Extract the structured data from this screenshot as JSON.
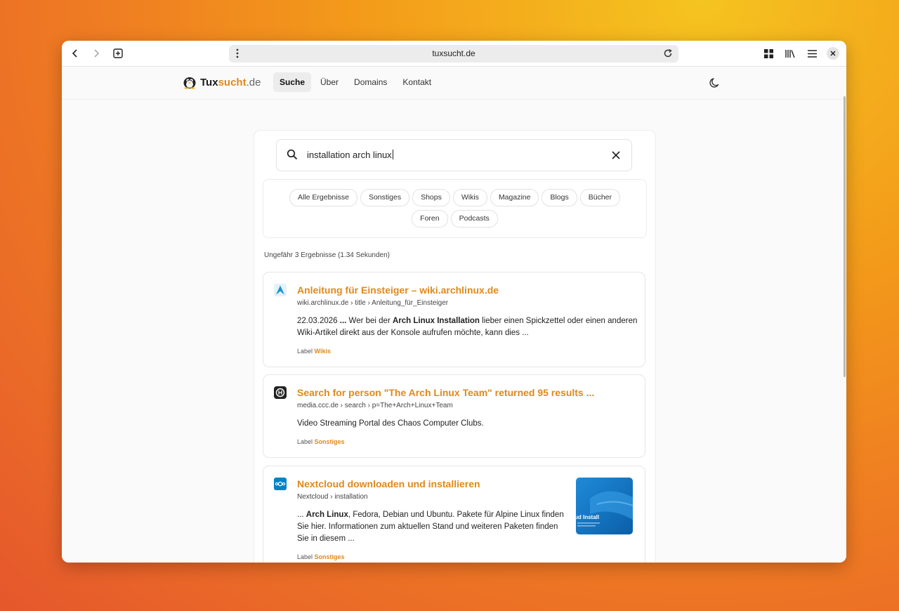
{
  "browser": {
    "url": "tuxsucht.de",
    "accent": "#e0891a"
  },
  "site": {
    "logo_tux": "Tux",
    "logo_sucht": "sucht",
    "logo_de": ".de",
    "nav": [
      {
        "label": "Suche",
        "active": true
      },
      {
        "label": "Über"
      },
      {
        "label": "Domains"
      },
      {
        "label": "Kontakt"
      }
    ]
  },
  "search": {
    "query": "installation arch linux",
    "filters_row1": [
      "Alle Ergebnisse",
      "Sonstiges",
      "Shops",
      "Wikis",
      "Magazine",
      "Blogs",
      "Bücher"
    ],
    "filters_row2": [
      "Foren",
      "Podcasts"
    ],
    "result_count": "Ungefähr 3 Ergebnisse (1.34 Sekunden)"
  },
  "results": [
    {
      "title": "Anleitung für Einsteiger – wiki.archlinux.de",
      "crumb": "wiki.archlinux.de › title › Anleitung_für_Einsteiger",
      "snippet_parts": [
        {
          "text": "22.03.2026 ",
          "bold": false
        },
        {
          "text": "...",
          "bold": true
        },
        {
          "text": " Wer bei der ",
          "bold": false
        },
        {
          "text": "Arch Linux Installation",
          "bold": true
        },
        {
          "text": " lieber einen Spickzettel oder einen anderen Wiki-Artikel direkt aus der Konsole aufrufen möchte, kann dies ...",
          "bold": false
        }
      ],
      "label_prefix": "Label",
      "label": "Wikis"
    },
    {
      "title": "Search for person \"The Arch Linux Team\" returned 95 results ...",
      "crumb": "media.ccc.de › search › p=The+Arch+Linux+Team",
      "snippet_parts": [
        {
          "text": "Video Streaming Portal des Chaos Computer Clubs.",
          "bold": false
        }
      ],
      "label_prefix": "Label",
      "label": "Sonstiges"
    },
    {
      "title": "Nextcloud downloaden und installieren",
      "crumb": "Nextcloud › installation",
      "snippet_parts": [
        {
          "text": "... ",
          "bold": false
        },
        {
          "text": "Arch Linux",
          "bold": true
        },
        {
          "text": ", Fedora, Debian und Ubuntu. Pakete für Alpine Linux finden Sie hier. Informationen zum aktuellen Stand und weiteren Paketen finden Sie in diesem ...",
          "bold": false
        }
      ],
      "label_prefix": "Label",
      "label": "Sonstiges",
      "thumb_text": "ud Install"
    }
  ]
}
